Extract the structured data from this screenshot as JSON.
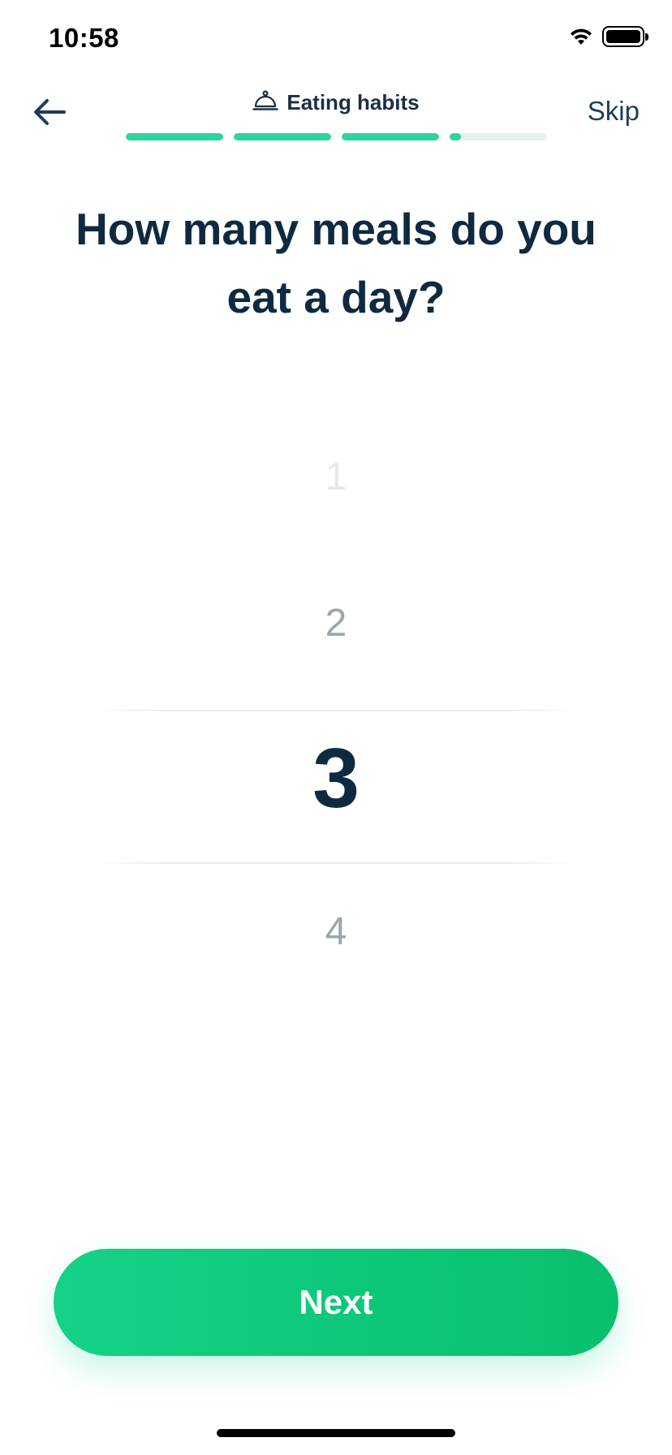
{
  "status_bar": {
    "time": "10:58",
    "icons": [
      "wifi-icon",
      "battery-icon"
    ]
  },
  "nav": {
    "back_icon": "arrow-left-icon",
    "section_icon": "cloche-icon",
    "section_label": "Eating habits",
    "skip_label": "Skip",
    "progress": [
      1.0,
      1.0,
      1.0,
      0.12
    ]
  },
  "question": {
    "line1": "How many meals do you",
    "line2": "eat a day?"
  },
  "picker": {
    "options_visible": [
      "1",
      "2",
      "3",
      "4"
    ],
    "selected": "3"
  },
  "next_button": {
    "label": "Next"
  },
  "colors": {
    "accent": "#14d287",
    "progress": "#2fd3a0",
    "progress_track": "#e4f1ec",
    "text_dark": "#0f2a40",
    "text_muted": "#9aa6ad"
  }
}
